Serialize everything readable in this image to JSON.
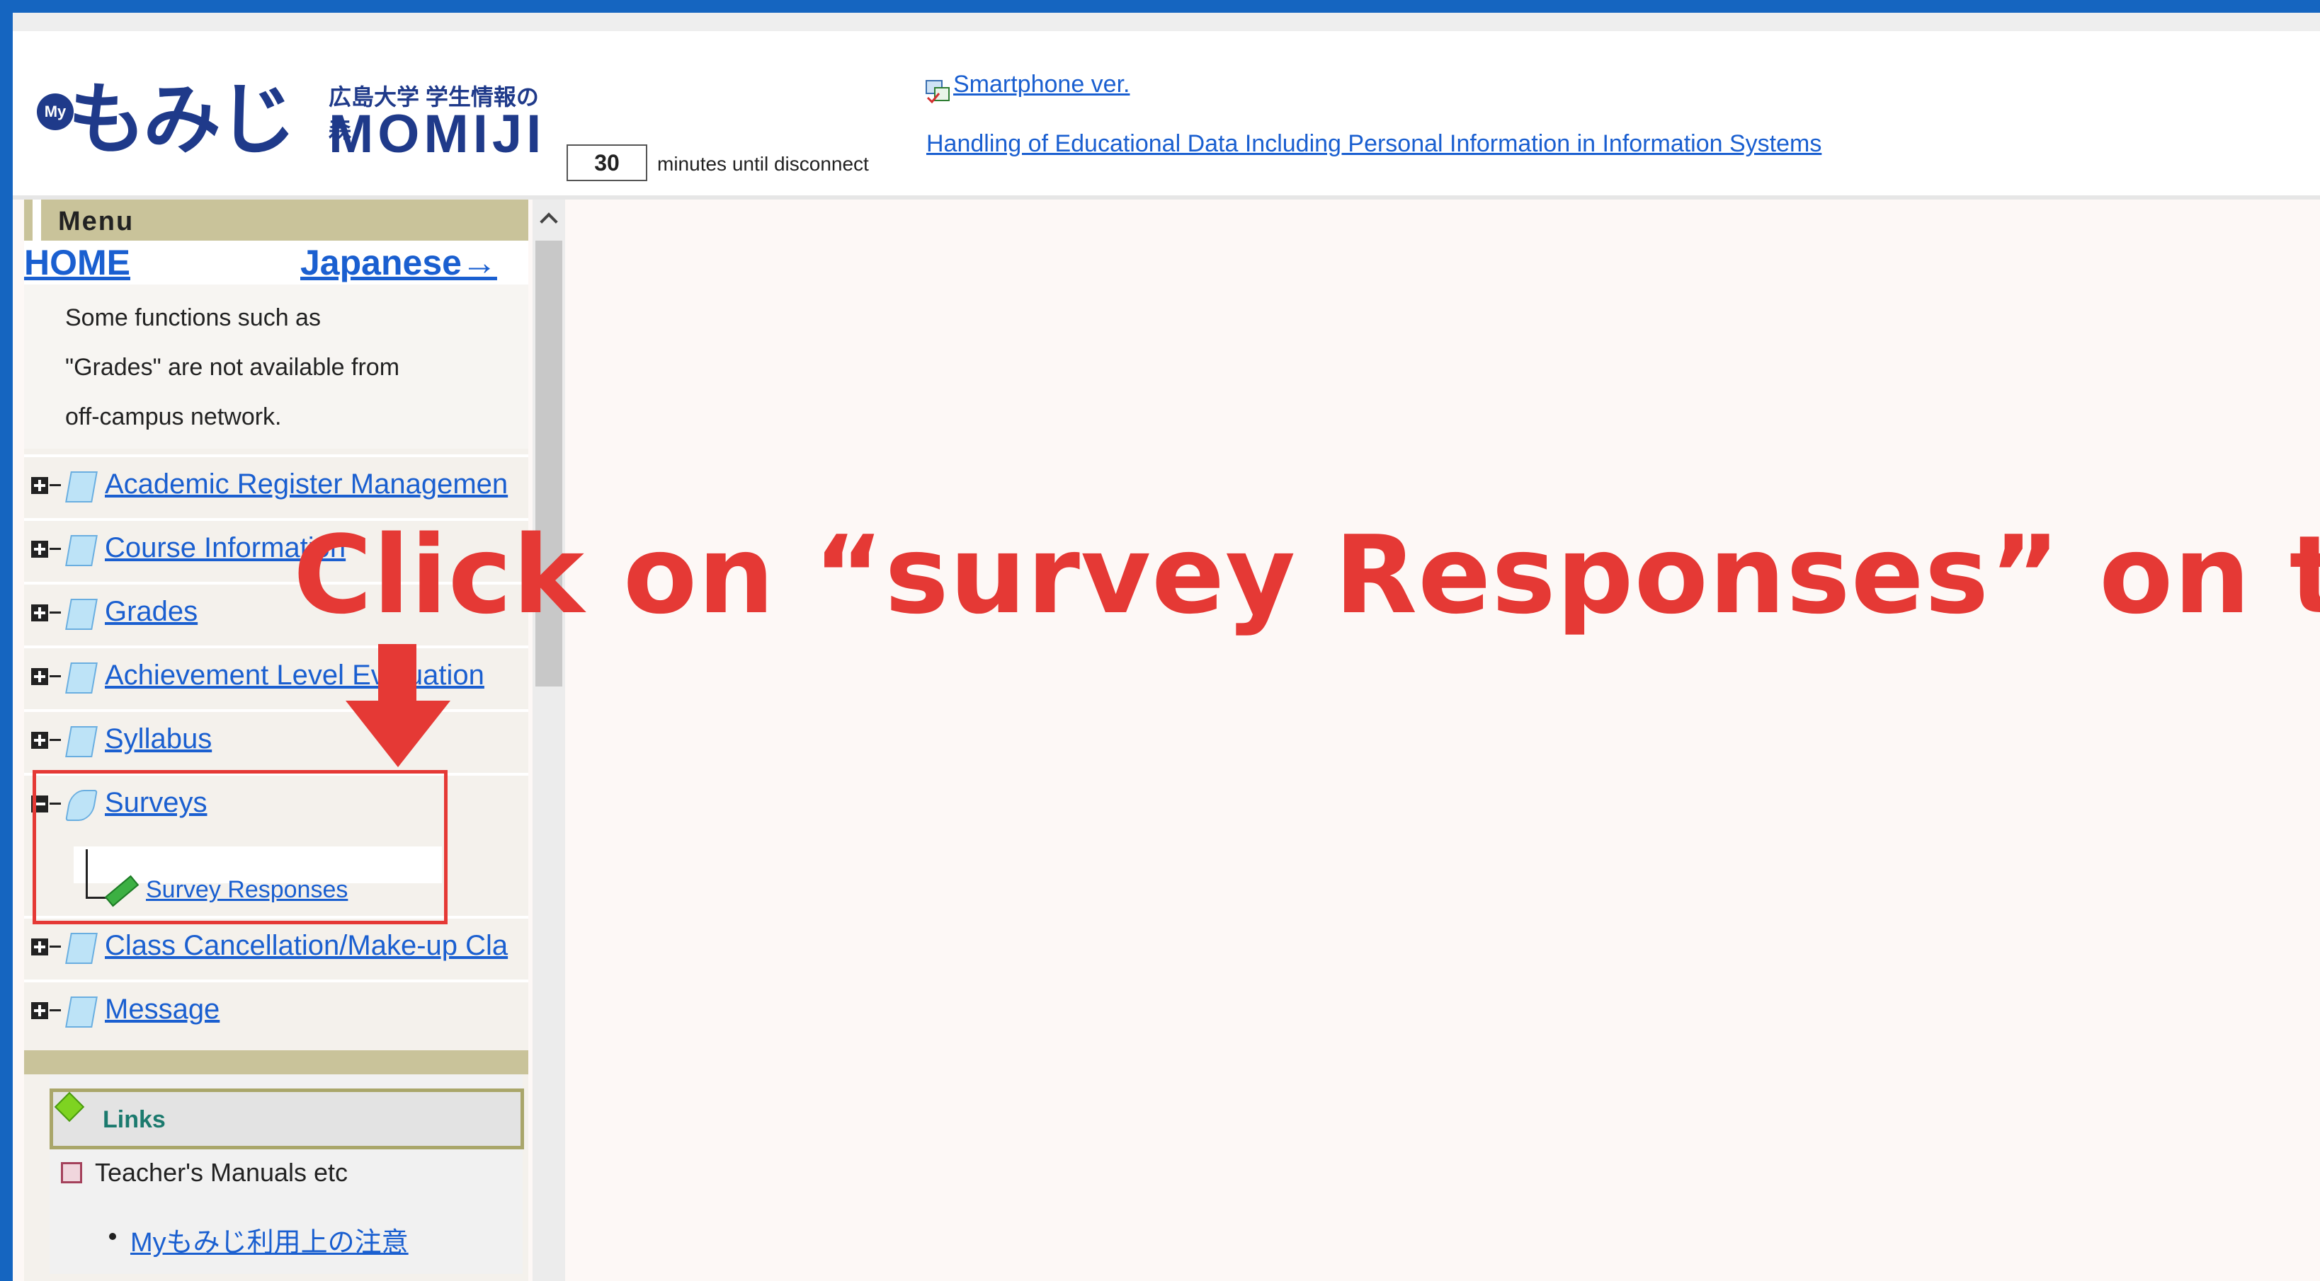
{
  "header": {
    "logo_my": "My",
    "logo_kana": "もみじ",
    "logo_small": "広島大学 学生情報の森",
    "logo_roman": "MOMIJI",
    "timer_value": "30",
    "timer_text": "minutes until disconnect",
    "smartphone_link": "Smartphone ver.",
    "handling_link": "Handling of Educational Data Including Personal Information in Information Systems"
  },
  "menu": {
    "title": "Menu",
    "home": "HOME",
    "japanese": "Japanese→",
    "notice": [
      "Some functions such as",
      "\"Grades\" are not available from",
      "off-campus network."
    ],
    "items": [
      {
        "label": "Academic Register Managemen"
      },
      {
        "label": "Course Information"
      },
      {
        "label": "Grades"
      },
      {
        "label": "Achievement Level Evaluation"
      },
      {
        "label": "Syllabus"
      },
      {
        "label": "Surveys"
      },
      {
        "label": "Class Cancellation/Make-up Cla"
      },
      {
        "label": "Message"
      }
    ],
    "survey_sub": "Survey Responses"
  },
  "links": {
    "title": "Links",
    "item": "Teacher's Manuals etc",
    "sub": "Myもみじ利用上の注意"
  },
  "instruction": "Click on “survey Responses” on the menu.",
  "colors": {
    "accent": "#e53935",
    "link": "#1a5fd0",
    "frame": "#1565c0",
    "menu_bar": "#c9c39a"
  }
}
